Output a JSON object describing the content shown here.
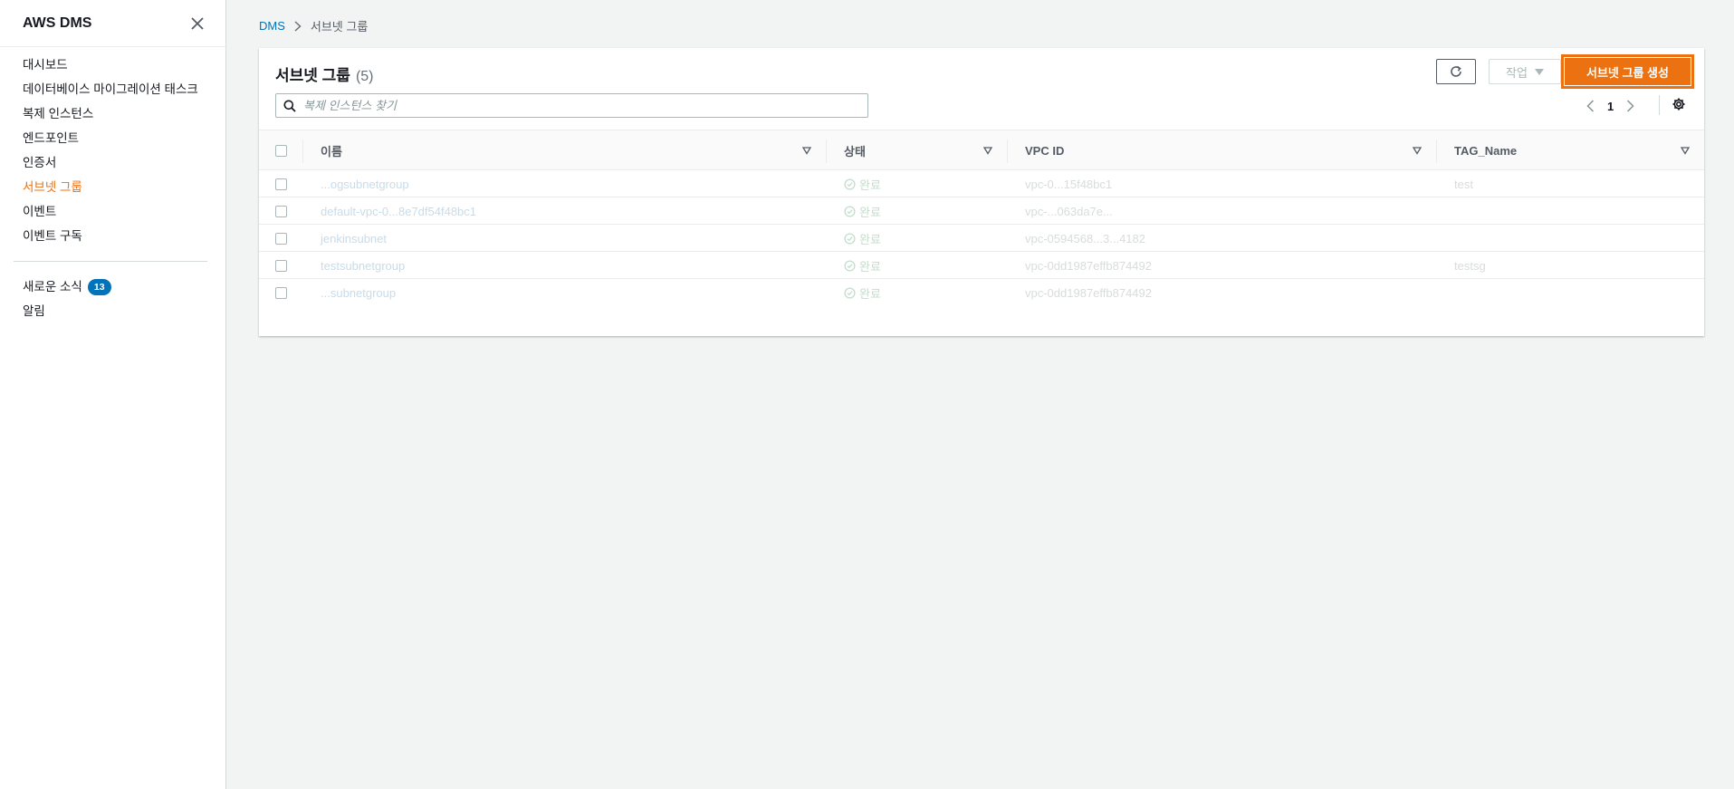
{
  "sidebar": {
    "title": "AWS DMS",
    "items": [
      {
        "label": "대시보드",
        "active": false
      },
      {
        "label": "데이터베이스 마이그레이션 태스크",
        "active": false
      },
      {
        "label": "복제 인스턴스",
        "active": false
      },
      {
        "label": "엔드포인트",
        "active": false
      },
      {
        "label": "인증서",
        "active": false
      },
      {
        "label": "서브넷 그룹",
        "active": true
      },
      {
        "label": "이벤트",
        "active": false
      },
      {
        "label": "이벤트 구독",
        "active": false
      }
    ],
    "news_label": "새로운 소식",
    "news_count": "13",
    "alerts_label": "알림"
  },
  "breadcrumb": {
    "root": "DMS",
    "current": "서브넷 그룹"
  },
  "panel": {
    "title": "서브넷 그룹",
    "count": "(5)",
    "action_label": "작업",
    "create_label": "서브넷 그룹 생성",
    "search_placeholder": "복제 인스턴스 찾기",
    "page": "1"
  },
  "table": {
    "columns": [
      "이름",
      "상태",
      "VPC ID",
      "TAG_Name"
    ],
    "rows": [
      {
        "name": "...ogsubnetgroup",
        "status": "완료",
        "vpc": "vpc-0...15f48bc1",
        "tag": "test"
      },
      {
        "name": "default-vpc-0...8e7df54f48bc1",
        "status": "완료",
        "vpc": "vpc-...063da7e...",
        "tag": ""
      },
      {
        "name": "jenkinsubnet",
        "status": "완료",
        "vpc": "vpc-0594568...3...4182",
        "tag": ""
      },
      {
        "name": "testsubnetgroup",
        "status": "완료",
        "vpc": "vpc-0dd1987effb874492",
        "tag": "testsg"
      },
      {
        "name": "...subnetgroup",
        "status": "완료",
        "vpc": "vpc-0dd1987effb874492",
        "tag": ""
      }
    ]
  },
  "colors": {
    "accent": "#ec7211",
    "link": "#0073bb",
    "badge": "#0073bb"
  }
}
